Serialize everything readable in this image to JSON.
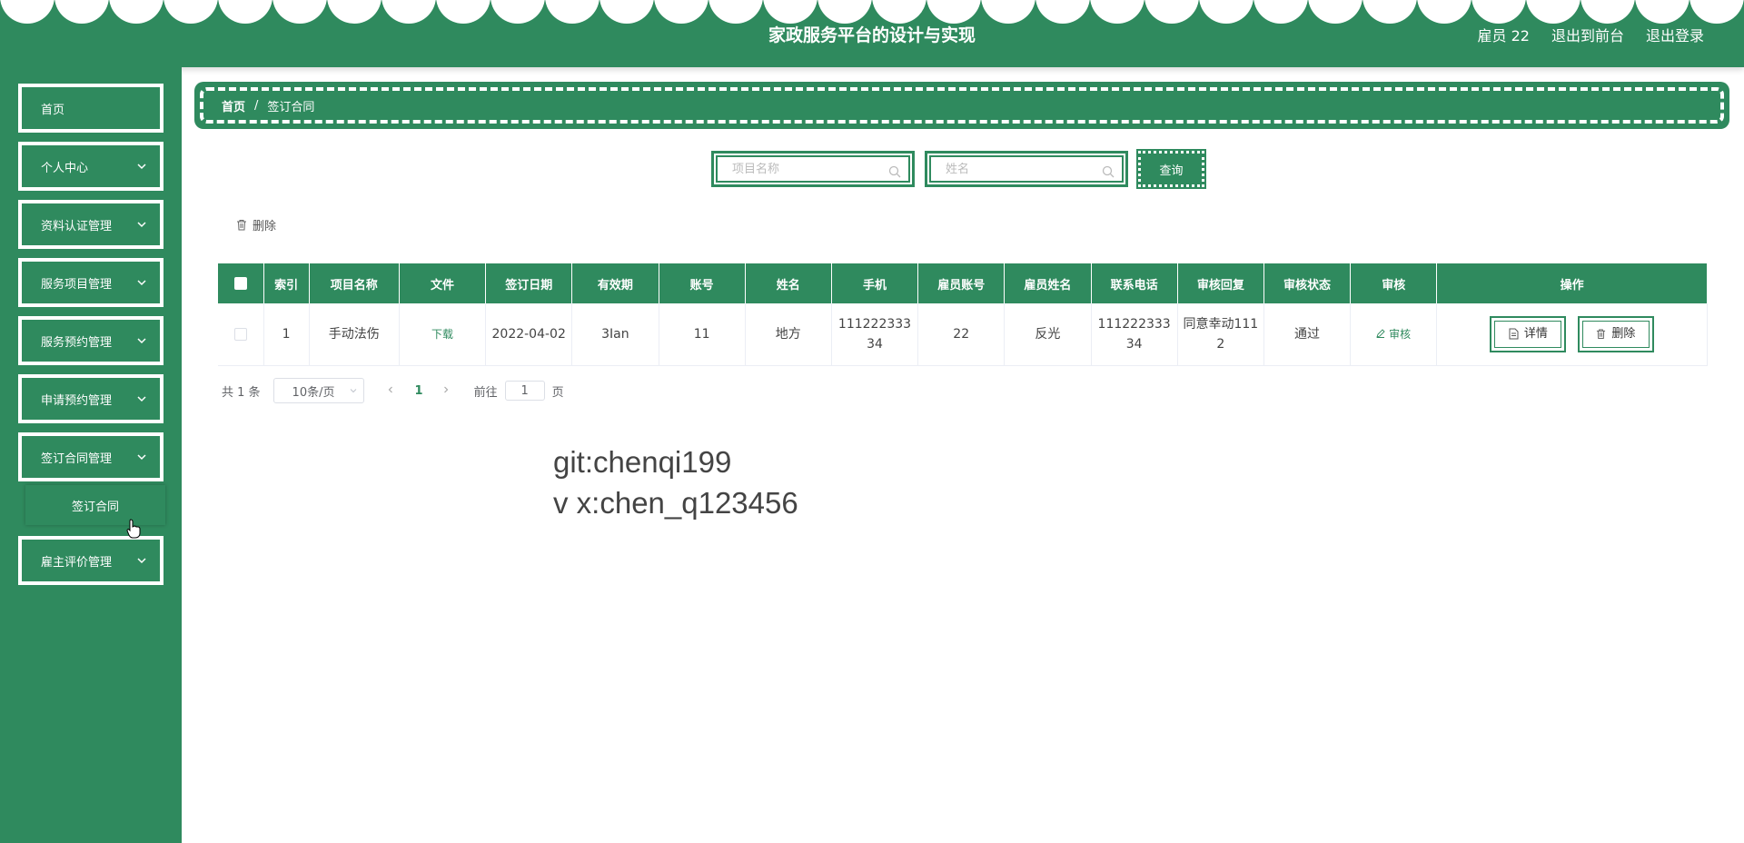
{
  "header": {
    "title": "家政服务平台的设计与实现",
    "user": "雇员 22",
    "to_front": "退出到前台",
    "logout": "退出登录",
    "color": "#2f8a5e"
  },
  "sidebar": {
    "items": [
      {
        "label": "首页",
        "has_children": false
      },
      {
        "label": "个人中心",
        "has_children": true
      },
      {
        "label": "资料认证管理",
        "has_children": true
      },
      {
        "label": "服务项目管理",
        "has_children": true
      },
      {
        "label": "服务预约管理",
        "has_children": true
      },
      {
        "label": "申请预约管理",
        "has_children": true
      },
      {
        "label": "签订合同管理",
        "has_children": true,
        "expanded": true
      },
      {
        "label": "雇主评价管理",
        "has_children": true
      }
    ],
    "submenu": {
      "label": "签订合同"
    }
  },
  "breadcrumb": {
    "home": "首页",
    "separator": "/",
    "current": "签订合同"
  },
  "search": {
    "project_placeholder": "项目名称",
    "name_placeholder": "姓名",
    "query_label": "查询"
  },
  "toolbar": {
    "delete_label": "删除"
  },
  "table": {
    "columns": [
      "索引",
      "项目名称",
      "文件",
      "签订日期",
      "有效期",
      "账号",
      "姓名",
      "手机",
      "雇员账号",
      "雇员姓名",
      "联系电话",
      "审核回复",
      "审核状态",
      "审核",
      "操作"
    ],
    "rows": [
      {
        "index": "1",
        "project": "手动法伤",
        "file": "下载",
        "date": "2022-04-02",
        "validity": "3Ian",
        "account": "11",
        "name": "地方",
        "phone": "11122233334",
        "employee_account": "22",
        "employee_name": "反光",
        "contact_phone": "11122233334",
        "review_reply": "同意幸动1112",
        "review_status": "通过",
        "review_action": "审核",
        "detail_label": "详情",
        "delete_label": "删除"
      }
    ]
  },
  "pagination": {
    "total": "共 1 条",
    "page_size": "10条/页",
    "current_page": "1",
    "goto_prefix": "前往",
    "goto_value": "1",
    "goto_suffix": "页"
  },
  "watermark": {
    "line1": "git:chenqi199",
    "line2": "v x:chen_q123456"
  }
}
